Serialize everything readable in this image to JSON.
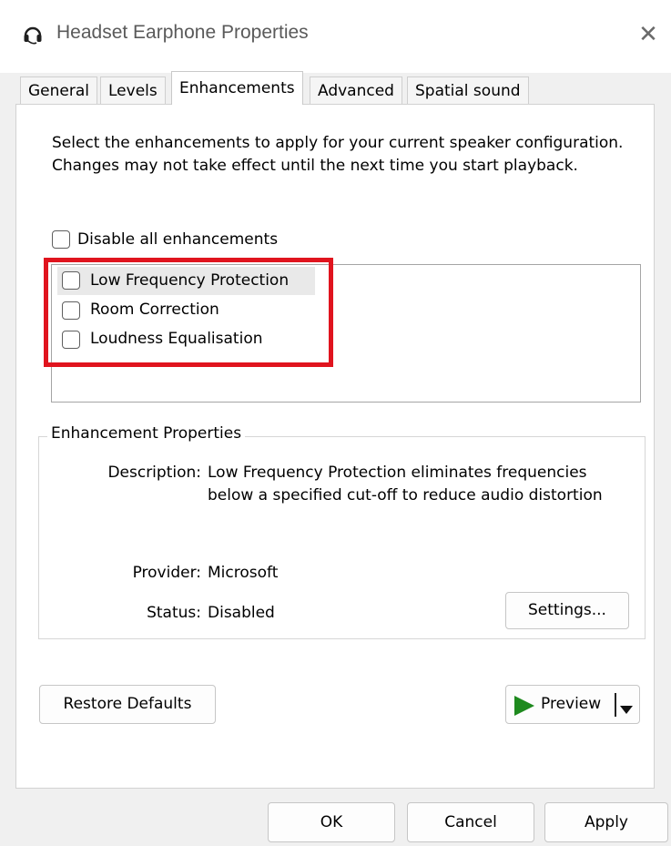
{
  "window": {
    "title": "Headset Earphone Properties",
    "close_glyph": "✕",
    "icon": "headset-icon"
  },
  "tabs": [
    {
      "label": "General"
    },
    {
      "label": "Levels"
    },
    {
      "label": "Enhancements",
      "active": true
    },
    {
      "label": "Advanced"
    },
    {
      "label": "Spatial sound"
    }
  ],
  "enhancements": {
    "intro": "Select the enhancements to apply for your current speaker configuration. Changes may not take effect until the next time you start playback.",
    "disable_all": {
      "label": "Disable all enhancements",
      "checked": false
    },
    "items": [
      {
        "label": "Low Frequency Protection",
        "checked": false,
        "selected": true
      },
      {
        "label": "Room Correction",
        "checked": false
      },
      {
        "label": "Loudness Equalisation",
        "checked": false
      }
    ],
    "highlight_color": "#e0141e"
  },
  "properties": {
    "group_title": "Enhancement Properties",
    "description_label": "Description:",
    "description_value": "Low Frequency Protection eliminates frequencies below a specified cut-off to reduce audio distortion",
    "provider_label": "Provider:",
    "provider_value": "Microsoft",
    "status_label": "Status:",
    "status_value": "Disabled",
    "settings_button": "Settings..."
  },
  "actions": {
    "restore_defaults": "Restore Defaults",
    "preview": "Preview",
    "preview_icon": "play-icon",
    "preview_dropdown_icon": "chevron-down-icon"
  },
  "footer": {
    "ok": "OK",
    "cancel": "Cancel",
    "apply": "Apply"
  }
}
